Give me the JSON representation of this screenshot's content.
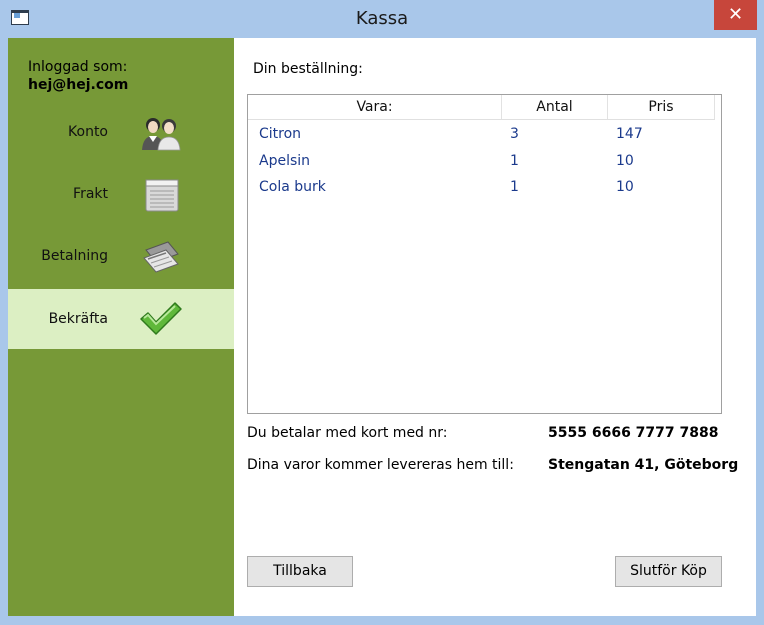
{
  "window": {
    "title": "Kassa",
    "close_label": "✕"
  },
  "sidebar": {
    "logged_in_label": "Inloggad som:",
    "logged_in_user": "hej@hej.com",
    "items": [
      {
        "label": "Konto",
        "icon": "users-icon",
        "active": false
      },
      {
        "label": "Frakt",
        "icon": "package-icon",
        "active": false
      },
      {
        "label": "Betalning",
        "icon": "payment-icon",
        "active": false
      },
      {
        "label": "Bekräfta",
        "icon": "checkmark-icon",
        "active": true
      }
    ]
  },
  "order": {
    "heading": "Din beställning:",
    "columns": [
      "Vara:",
      "Antal",
      "Pris"
    ],
    "rows": [
      {
        "item": "Citron",
        "qty": "3",
        "price": "147"
      },
      {
        "item": "Apelsin",
        "qty": "1",
        "price": "10"
      },
      {
        "item": "Cola burk",
        "qty": "1",
        "price": "10"
      }
    ]
  },
  "payment": {
    "label": "Du betalar med kort med nr:",
    "value": "5555 6666 7777 7888"
  },
  "delivery": {
    "label": "Dina varor kommer levereras hem till:",
    "value": "Stengatan 41, Göteborg"
  },
  "buttons": {
    "back": "Tillbaka",
    "finish": "Slutför Köp"
  },
  "colors": {
    "sidebar": "#779937",
    "active_item": "#dcefc3",
    "titlebar": "#a9c7ea",
    "close": "#c7463b",
    "row_text": "#1b3a8c"
  }
}
